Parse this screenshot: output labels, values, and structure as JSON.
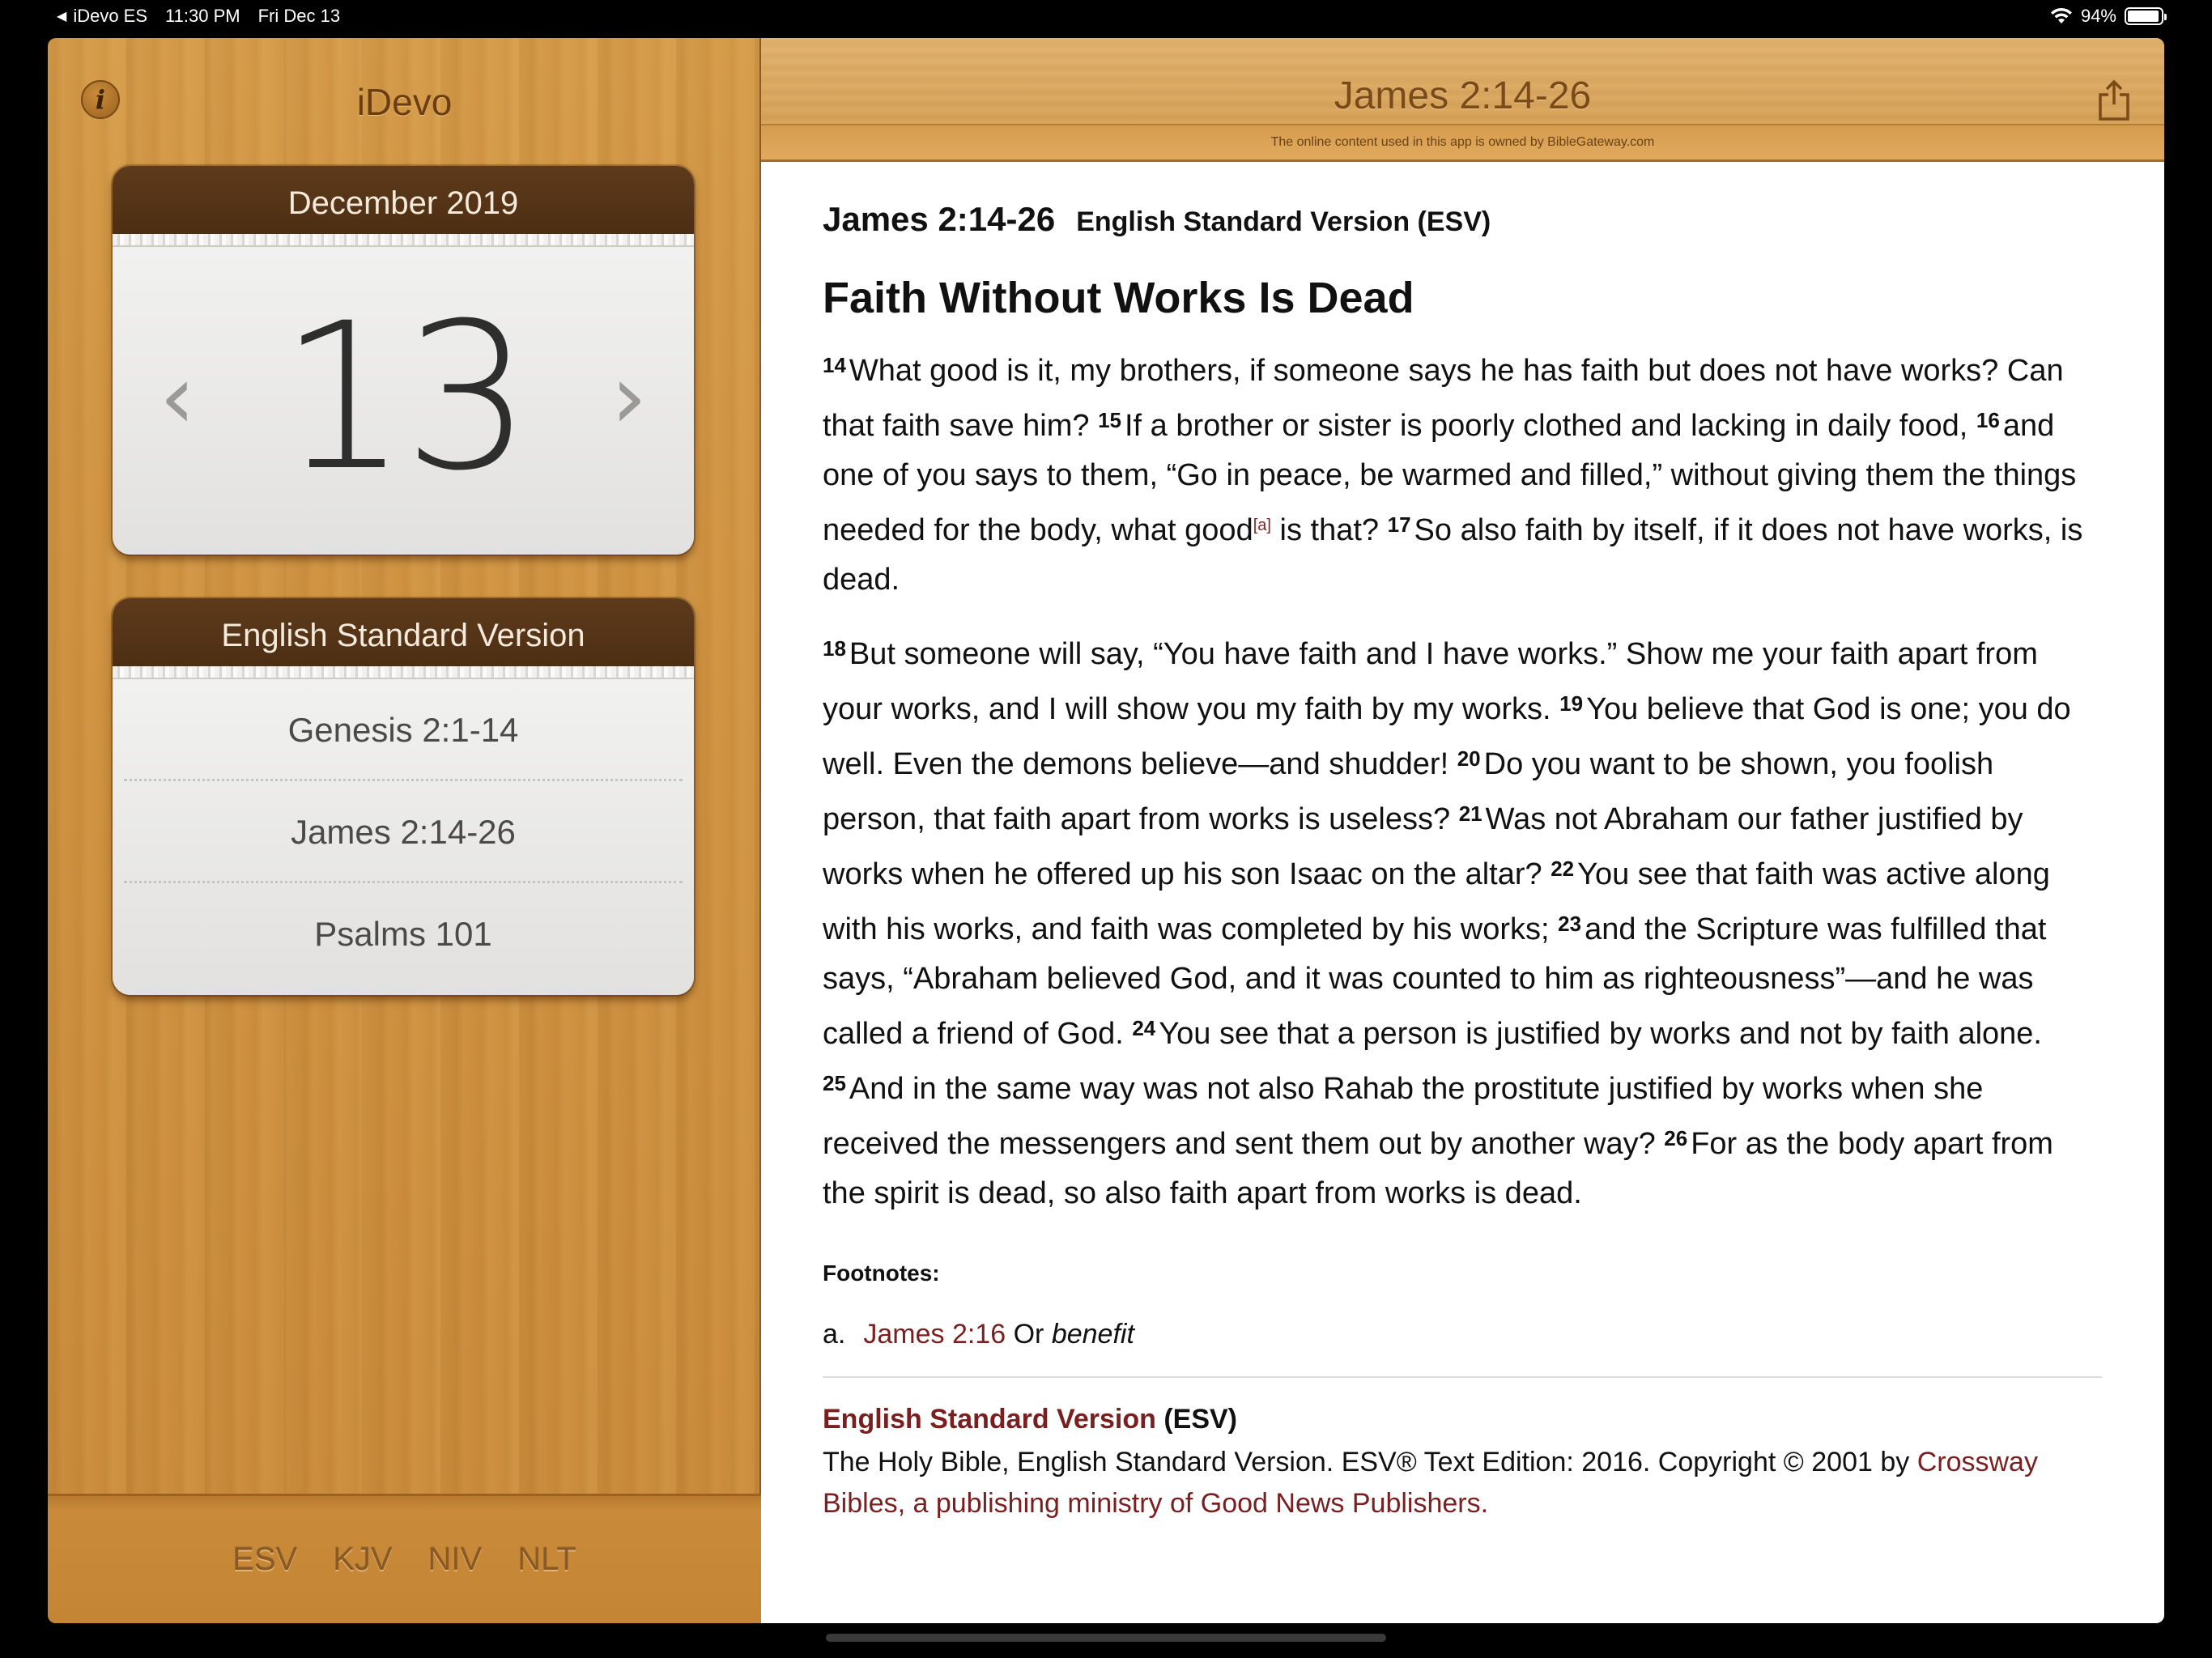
{
  "status_bar": {
    "back_app": "iDevo ES",
    "time": "11:30 PM",
    "date": "Fri Dec 13",
    "battery": "94%",
    "battery_level": 0.94
  },
  "sidebar": {
    "info_label": "i",
    "title": "iDevo",
    "calendar": {
      "month": "December 2019",
      "day": "13",
      "prev_glyph": "‹",
      "next_glyph": "›"
    },
    "readings": {
      "header": "English Standard Version",
      "items": [
        {
          "label": "Genesis 2:1-14"
        },
        {
          "label": "James 2:14-26"
        },
        {
          "label": "Psalms 101"
        }
      ]
    },
    "versions": [
      "ESV",
      "KJV",
      "NIV",
      "NLT"
    ]
  },
  "main": {
    "title": "James 2:14-26",
    "attribution": "The online content used in this app is owned by BibleGateway.com",
    "passage_ref": "James 2:14-26",
    "version_name": "English Standard Version (ESV)",
    "heading": "Faith Without Works Is Dead",
    "paragraphs": [
      [
        {
          "n": "14",
          "t": "What good is it, my brothers, if someone says he has faith but does not have works? Can that faith save him?"
        },
        {
          "n": "15",
          "t": "If a brother or sister is poorly clothed and lacking in daily food,"
        },
        {
          "n": "16",
          "t": "and one of you says to them, “Go in peace, be warmed and filled,” without giving them the things needed for the body, what good",
          "fn": "[a]",
          "t2": "is that?"
        },
        {
          "n": "17",
          "t": "So also faith by itself, if it does not have works, is dead."
        }
      ],
      [
        {
          "n": "18",
          "t": "But someone will say, “You have faith and I have works.” Show me your faith apart from your works, and I will show you my faith by my works."
        },
        {
          "n": "19",
          "t": "You believe that God is one; you do well. Even the demons believe—and shudder!"
        },
        {
          "n": "20",
          "t": "Do you want to be shown, you foolish person, that faith apart from works is useless?"
        },
        {
          "n": "21",
          "t": "Was not Abraham our father justified by works when he offered up his son Isaac on the altar?"
        },
        {
          "n": "22",
          "t": "You see that faith was active along with his works, and faith was completed by his works;"
        },
        {
          "n": "23",
          "t": "and the Scripture was fulfilled that says, “Abraham believed God, and it was counted to him as righteousness”—and he was called a friend of God."
        },
        {
          "n": "24",
          "t": "You see that a person is justified by works and not by faith alone."
        },
        {
          "n": "25",
          "t": "And in the same way was not also Rahab the prostitute justified by works when she received the messengers and sent them out by another way?"
        },
        {
          "n": "26",
          "t": "For as the body apart from the spirit is dead, so also faith apart from works is dead."
        }
      ]
    ],
    "footnotes_label": "Footnotes:",
    "footnote": {
      "marker": "a.",
      "link": "James 2:16",
      "text": "Or",
      "italic": "benefit"
    },
    "copyright": {
      "version_link": "English Standard Version",
      "abbr": "(ESV)",
      "text": "The Holy Bible, English Standard Version. ESV® Text Edition: 2016. Copyright © 2001 by",
      "publisher_link": "Crossway Bibles, a publishing ministry of Good News Publishers."
    }
  },
  "colors": {
    "wood": "#cf9240",
    "card_header": "#4a2c12",
    "link": "#7a1f1f"
  }
}
